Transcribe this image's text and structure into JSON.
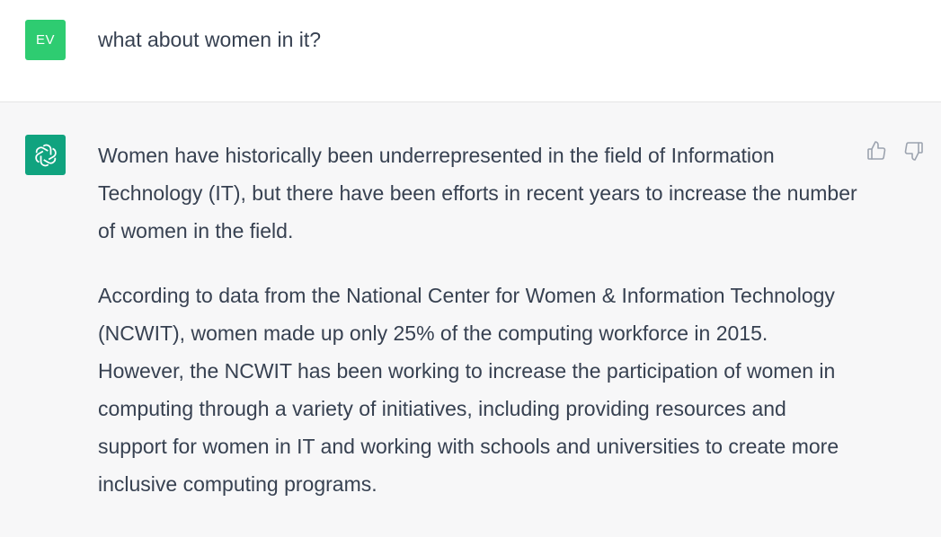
{
  "user_message": {
    "avatar_initials": "EV",
    "text": "what about women in it?"
  },
  "assistant_message": {
    "avatar_icon": "openai-logo-icon",
    "paragraphs": [
      "Women have historically been underrepresented in the field of Information Technology (IT), but there have been efforts in recent years to increase the number of women in the field.",
      "According to data from the National Center for Women & Information Technology (NCWIT), women made up only 25% of the computing workforce in 2015. However, the NCWIT has been working to increase the participation of women in computing through a variety of initiatives, including providing resources and support for women in IT and working with schools and universities to create more inclusive computing programs."
    ]
  },
  "feedback": {
    "thumbs_up_icon": "thumbs-up-icon",
    "thumbs_down_icon": "thumbs-down-icon"
  },
  "colors": {
    "user_avatar_bg": "#2ecc71",
    "bot_avatar_bg": "#10a37f",
    "assistant_row_bg": "#f7f7f8",
    "text": "#374151",
    "icon": "#9ca3af"
  }
}
